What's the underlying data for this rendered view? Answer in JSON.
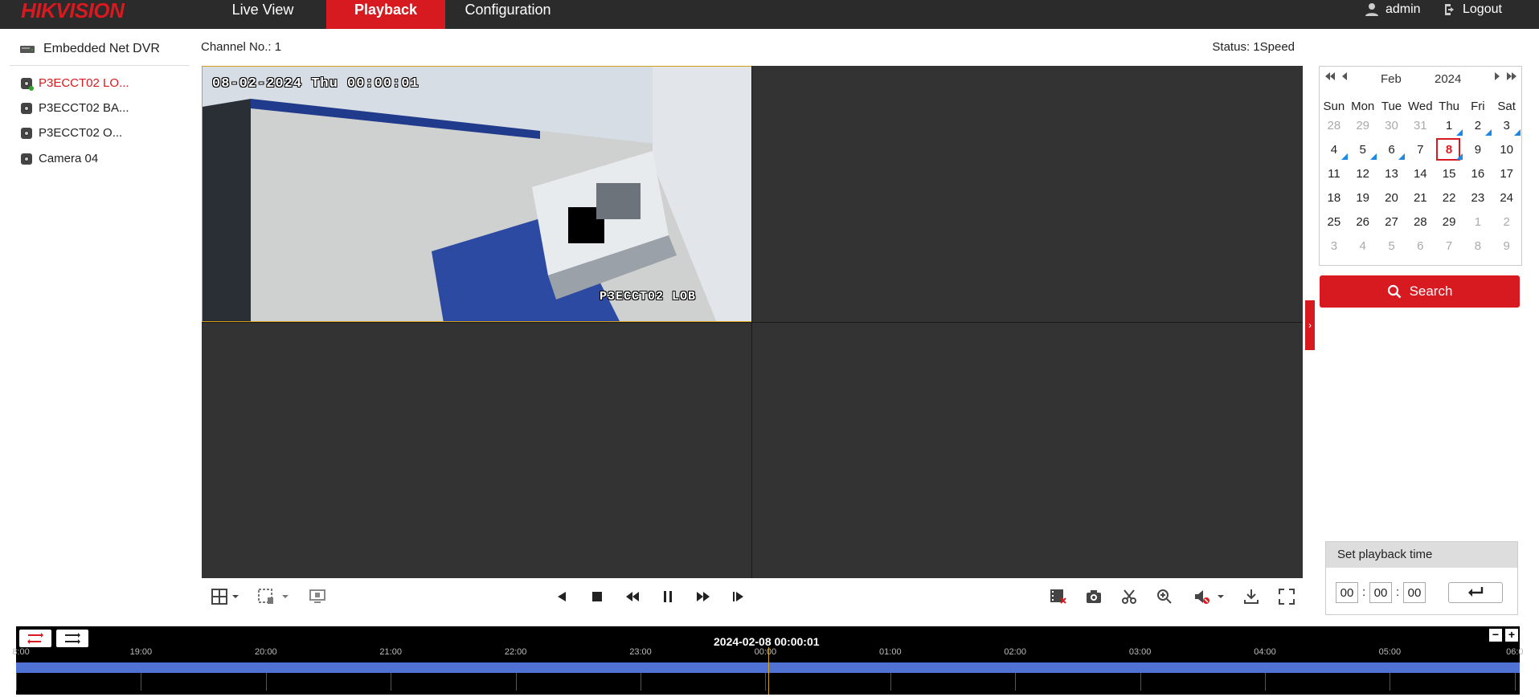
{
  "brand": "HIKVISION",
  "nav": [
    "Live View",
    "Playback",
    "Configuration"
  ],
  "user": {
    "name": "admin",
    "logout": "Logout"
  },
  "device": {
    "name": "Embedded Net DVR"
  },
  "cameras": [
    "P3ECCT02 LO...",
    "P3ECCT02 BA...",
    "P3ECCT02 O...",
    "Camera 04"
  ],
  "channel_label": "Channel No.: 1",
  "status_label": "Status: 1Speed",
  "video": {
    "osd_time": "08-02-2024 Thu 00:00:01",
    "osd_name": "P3ECCT02 LOB"
  },
  "calendar": {
    "month": "Feb",
    "year": "2024",
    "weekdays": [
      "Sun",
      "Mon",
      "Tue",
      "Wed",
      "Thu",
      "Fri",
      "Sat"
    ],
    "weeks": [
      [
        "28",
        "29",
        "30",
        "31",
        "1",
        "2",
        "3"
      ],
      [
        "4",
        "5",
        "6",
        "7",
        "8",
        "9",
        "10"
      ],
      [
        "11",
        "12",
        "13",
        "14",
        "15",
        "16",
        "17"
      ],
      [
        "18",
        "19",
        "20",
        "21",
        "22",
        "23",
        "24"
      ],
      [
        "25",
        "26",
        "27",
        "28",
        "29",
        "1",
        "2"
      ],
      [
        "3",
        "4",
        "5",
        "6",
        "7",
        "8",
        "9"
      ]
    ],
    "selected_day": "8",
    "recorded_days": [
      "1",
      "2",
      "3",
      "4",
      "5",
      "6",
      "8"
    ]
  },
  "search_label": "Search",
  "playback_time": {
    "title": "Set playback time",
    "hh": "00",
    "mm": "00",
    "ss": "00"
  },
  "timeline": {
    "current": "2024-02-08 00:00:01",
    "ticks": [
      "8:00",
      "19:00",
      "20:00",
      "21:00",
      "22:00",
      "23:00",
      "00:00",
      "01:00",
      "02:00",
      "03:00",
      "04:00",
      "05:00",
      "06:0"
    ]
  },
  "colors": {
    "accent": "#d71920",
    "topbar": "#2b2b2b",
    "video_bg": "#333333",
    "record_bar": "#4f72d4",
    "cursor": "#d4a017"
  }
}
